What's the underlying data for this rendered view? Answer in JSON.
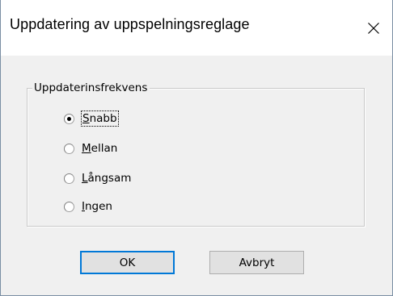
{
  "window": {
    "title": "Uppdatering av uppspelningsreglage",
    "close_icon": "close-icon"
  },
  "group": {
    "label": "Uppdaterinsfrekvens",
    "options": [
      {
        "label": "Snabb",
        "mnemonic": "S",
        "rest": "nabb",
        "checked": true
      },
      {
        "label": "Mellan",
        "mnemonic": "M",
        "rest": "ellan",
        "checked": false
      },
      {
        "label": "Långsam",
        "mnemonic": "L",
        "rest": "ångsam",
        "checked": false
      },
      {
        "label": "Ingen",
        "mnemonic": "I",
        "rest": "ngen",
        "checked": false
      }
    ]
  },
  "buttons": {
    "ok": "OK",
    "cancel": "Avbryt"
  },
  "colors": {
    "accent": "#0078d7",
    "dialog_bg": "#f0f0f0"
  }
}
